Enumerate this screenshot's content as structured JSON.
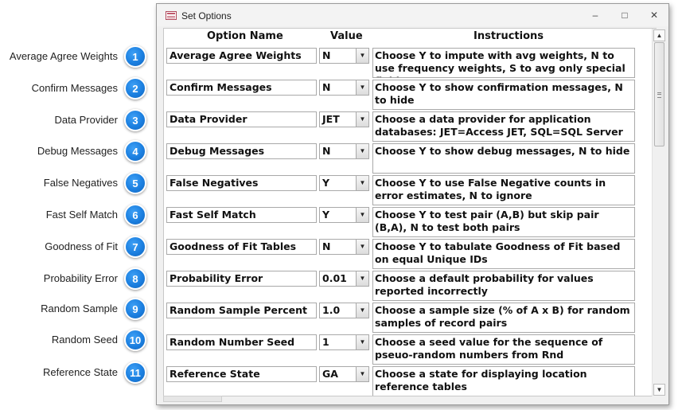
{
  "callouts": [
    {
      "label": "Average Agree Weights",
      "num": "1"
    },
    {
      "label": "Confirm Messages",
      "num": "2"
    },
    {
      "label": "Data Provider",
      "num": "3"
    },
    {
      "label": "Debug Messages",
      "num": "4"
    },
    {
      "label": "False Negatives",
      "num": "5"
    },
    {
      "label": "Fast Self Match",
      "num": "6"
    },
    {
      "label": "Goodness of Fit",
      "num": "7"
    },
    {
      "label": "Probability Error",
      "num": "8"
    },
    {
      "label": "Random Sample",
      "num": "9"
    },
    {
      "label": "Random Seed",
      "num": "10"
    },
    {
      "label": "Reference State",
      "num": "11"
    }
  ],
  "window": {
    "title": "Set Options",
    "minimize": "–",
    "restore": "□",
    "close": "✕"
  },
  "headers": {
    "name": "Option Name",
    "value": "Value",
    "instructions": "Instructions"
  },
  "rows": [
    {
      "name": "Average Agree Weights",
      "value": "N",
      "instructions": "Choose Y to impute with avg weights, N to use frequency weights, S to avg only special fields"
    },
    {
      "name": "Confirm Messages",
      "value": "N",
      "instructions": "Choose Y to show confirmation messages, N to hide"
    },
    {
      "name": "Data Provider",
      "value": "JET",
      "instructions": "Choose a data provider for application databases: JET=Access JET, SQL=SQL Server"
    },
    {
      "name": "Debug Messages",
      "value": "N",
      "instructions": "Choose Y to show debug messages, N to hide"
    },
    {
      "name": "False Negatives",
      "value": "Y",
      "instructions": "Choose Y to use False Negative counts in error estimates, N to ignore"
    },
    {
      "name": "Fast Self Match",
      "value": "Y",
      "instructions": "Choose Y to test pair (A,B) but skip pair (B,A), N to test both pairs"
    },
    {
      "name": "Goodness of Fit Tables",
      "value": "N",
      "instructions": "Choose Y to tabulate Goodness of Fit based on equal Unique IDs"
    },
    {
      "name": "Probability Error",
      "value": "0.01",
      "instructions": "Choose a default probability for values reported incorrectly"
    },
    {
      "name": "Random Sample Percent",
      "value": "1.0",
      "instructions": "Choose a sample size (% of A x B) for random samples of record pairs"
    },
    {
      "name": "Random Number Seed",
      "value": "1",
      "instructions": "Choose a seed value for the sequence of pseuo-random numbers from Rnd"
    },
    {
      "name": "Reference State",
      "value": "GA",
      "instructions": "Choose a state for displaying location reference tables"
    }
  ],
  "icons": {
    "combo_arrow": "chevron-down-icon",
    "scroll_up": "▲",
    "scroll_down": "▼",
    "combo_glyph": "▼"
  }
}
